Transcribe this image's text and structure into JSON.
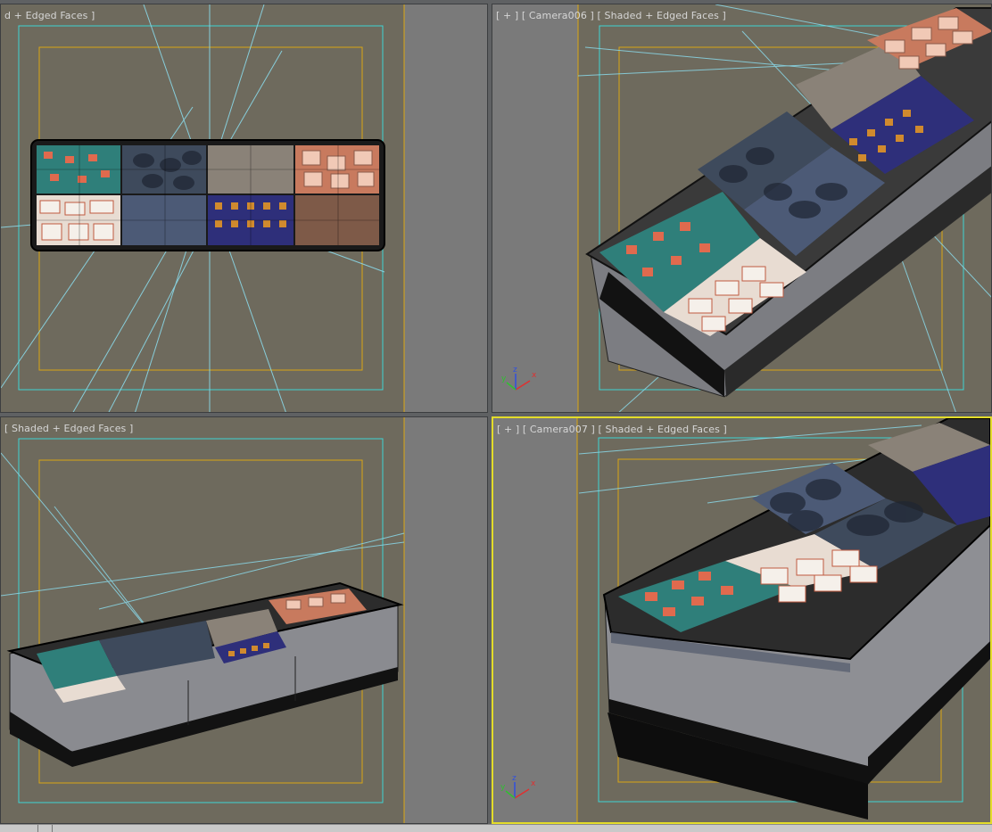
{
  "viewports": {
    "top_left": {
      "label": "d + Edged Faces ]",
      "view": "top",
      "active": false
    },
    "top_right": {
      "label": "[ + ] [ Camera006 ] [ Shaded + Edged Faces ]",
      "view": "camera-overhead",
      "active": false
    },
    "bottom_left": {
      "label": "[ Shaded + Edged Faces ]",
      "view": "perspective-low",
      "active": false
    },
    "bottom_right": {
      "label": "[ + ] [ Camera007 ] [ Shaded + Edged Faces ]",
      "view": "camera-close",
      "active": true
    }
  },
  "gizmo": {
    "x_label": "x",
    "y_label": "y",
    "z_label": "z"
  },
  "colors": {
    "viewport_bg": "#6e6a5d",
    "safe_frame_outer": "#3fd4d4",
    "safe_frame_inner": "#d9a514",
    "active_border": "#e3dc2a",
    "camera_lines": "#8ad8e8",
    "gutter": "#7a7a7a"
  }
}
